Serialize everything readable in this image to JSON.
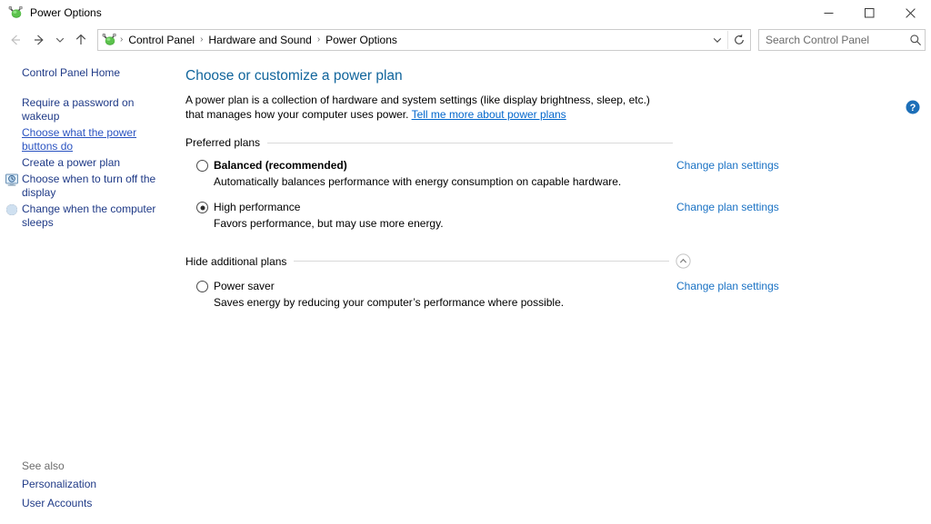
{
  "window": {
    "title": "Power Options",
    "icon": "power-plug-icon",
    "controls": {
      "minimize": "Minimize",
      "maximize": "Maximize",
      "close": "Close"
    }
  },
  "addressbar": {
    "back": "Back",
    "forward": "Forward",
    "recent": "Recent locations",
    "up": "Up one level",
    "breadcrumb_icon": "power-plug-icon",
    "separator": "›",
    "breadcrumbs": [
      "Control Panel",
      "Hardware and Sound",
      "Power Options"
    ],
    "dropdown": "chevron-down-icon",
    "refresh": "refresh-icon",
    "search": {
      "placeholder": "Search Control Panel",
      "value": "",
      "icon": "search-icon"
    }
  },
  "sidebar": {
    "home": "Control Panel Home",
    "items": [
      {
        "label": "Require a password on wakeup",
        "icon": null,
        "hovered": false
      },
      {
        "label": "Choose what the power buttons do",
        "icon": null,
        "hovered": true
      },
      {
        "label": "Create a power plan",
        "icon": null,
        "hovered": false
      },
      {
        "label": "Choose when to turn off the display",
        "icon": "monitor-clock-icon",
        "hovered": false
      },
      {
        "label": "Change when the computer sleeps",
        "icon": "moon-sleep-icon",
        "hovered": false
      }
    ],
    "see_also": {
      "title": "See also",
      "links": [
        "Personalization",
        "User Accounts"
      ]
    }
  },
  "main": {
    "help_icon": "help-question-icon",
    "title": "Choose or customize a power plan",
    "description_part1": "A power plan is a collection of hardware and system settings (like display brightness, sleep, etc.) that manages how your computer uses power. ",
    "description_link": "Tell me more about power plans",
    "sections": [
      {
        "label": "Preferred plans",
        "collapse_icon": null,
        "plans": [
          {
            "name": "Balanced (recommended)",
            "bold": true,
            "selected": false,
            "description": "Automatically balances performance with energy consumption on capable hardware.",
            "action": "Change plan settings"
          },
          {
            "name": "High performance",
            "bold": false,
            "selected": true,
            "description": "Favors performance, but may use more energy.",
            "action": "Change plan settings"
          }
        ]
      },
      {
        "label": "Hide additional plans",
        "collapse_icon": "chevron-up-circle-icon",
        "plans": [
          {
            "name": "Power saver",
            "bold": false,
            "selected": false,
            "description": "Saves energy by reducing your computer’s performance where possible.",
            "action": "Change plan settings"
          }
        ]
      }
    ]
  },
  "colors": {
    "title_blue": "#11659c",
    "link_blue": "#1a72c4",
    "sidebar_link": "#1f3a87",
    "hover_link": "#2a53c1",
    "help_blue": "#1d6fb8"
  }
}
